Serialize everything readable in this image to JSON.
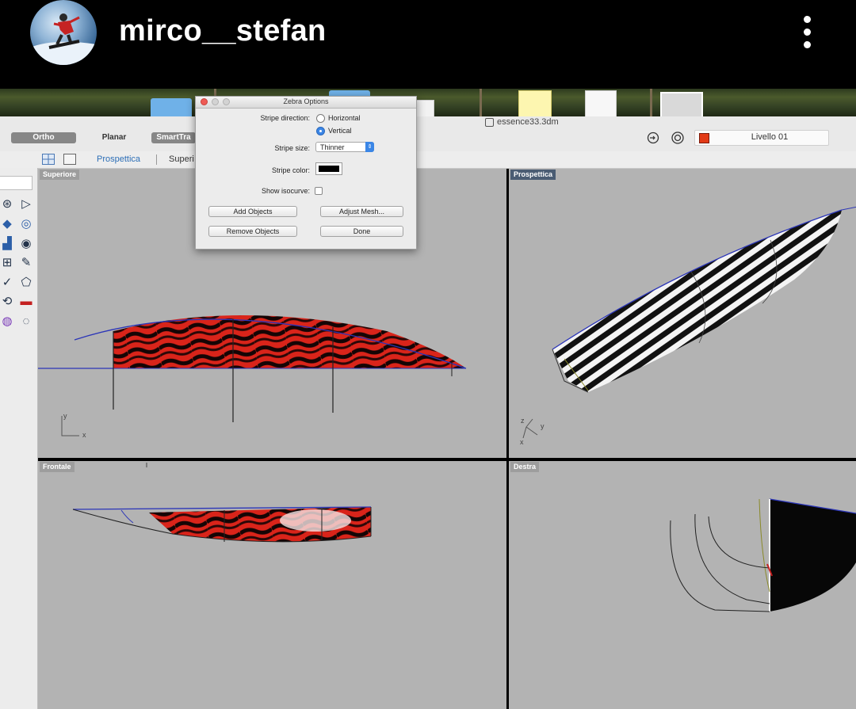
{
  "instagram": {
    "username": "mirco__stefan"
  },
  "app": {
    "document_title": "essence33.3dm",
    "modes": [
      "Ortho",
      "Planar",
      "SmartTra"
    ],
    "layer": {
      "name": "Livello 01",
      "color": "#e23a16"
    }
  },
  "viewport_tabs": [
    "Prospettica",
    "Superi"
  ],
  "viewports": {
    "top": "Superiore",
    "perspective": "Prospettica",
    "front": "Frontale",
    "right": "Destra"
  },
  "axes": {
    "x": "x",
    "y": "y",
    "z": "z"
  },
  "zebra_dialog": {
    "title": "Zebra Options",
    "stripe_direction_label": "Stripe direction:",
    "direction_options": [
      "Horizontal",
      "Vertical"
    ],
    "direction_selected": "Vertical",
    "stripe_size_label": "Stripe size:",
    "stripe_size_value": "Thinner",
    "stripe_color_label": "Stripe color:",
    "stripe_color": "#000000",
    "show_isocurve_label": "Show isocurve:",
    "buttons": {
      "add_objects": "Add Objects",
      "adjust_mesh": "Adjust Mesh...",
      "remove_objects": "Remove Objects",
      "done": "Done"
    }
  },
  "colors": {
    "viewport_bg": "#b3b3b3",
    "hull_red": "#d9241a",
    "curve_blue": "#3b3fc4"
  }
}
